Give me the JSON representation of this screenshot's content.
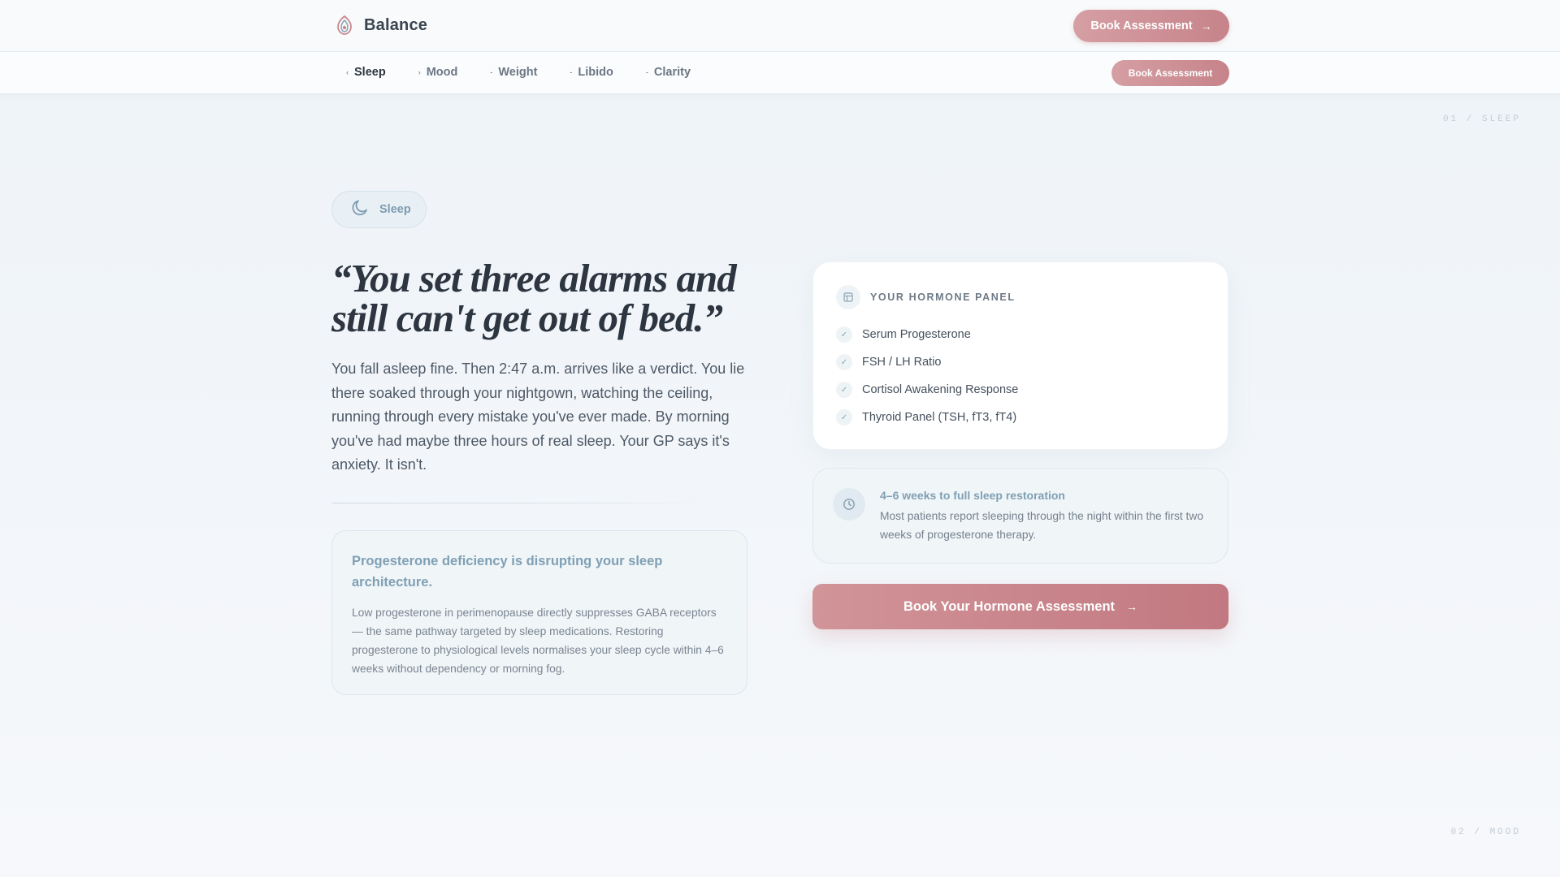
{
  "brand": {
    "name": "Balance"
  },
  "header": {
    "cta_label": "Book Assessment",
    "cta_arrow": "→"
  },
  "subnav": {
    "items": [
      {
        "label": "Sleep",
        "glyph": "‹",
        "active": true
      },
      {
        "label": "Mood",
        "glyph": "›",
        "active": false
      },
      {
        "label": "Weight",
        "glyph": "-",
        "active": false
      },
      {
        "label": "Libido",
        "glyph": "-",
        "active": false
      },
      {
        "label": "Clarity",
        "glyph": "-",
        "active": false
      }
    ],
    "cta_label": "Book Assessment"
  },
  "markers": {
    "current": "01 / SLEEP",
    "next": "02 / MOOD"
  },
  "hero": {
    "chip_label": "Sleep",
    "headline": "“You set three alarms and still can't get out of bed.”",
    "body": "You fall asleep fine. Then 2:47 a.m. arrives like a verdict. You lie there soaked through your nightgown, watching the ceiling, running through every mistake you've ever made. By morning you've had maybe three hours of real sleep. Your GP says it's anxiety. It isn't."
  },
  "insight": {
    "title": "Progesterone deficiency is disrupting your sleep architecture.",
    "body": "Low progesterone in perimenopause directly suppresses GABA receptors — the same pathway targeted by sleep medications. Restoring progesterone to physiological levels normalises your sleep cycle within 4–6 weeks without dependency or morning fog."
  },
  "panel": {
    "title": "YOUR HORMONE PANEL",
    "items": [
      {
        "label": "Serum Progesterone"
      },
      {
        "label": "FSH / LH Ratio"
      },
      {
        "label": "Cortisol Awakening Response"
      },
      {
        "label": "Thyroid Panel (TSH, fT3, fT4)"
      }
    ]
  },
  "timeline": {
    "title": "4–6 weeks to full sleep restoration",
    "body": "Most patients report sleeping through the night within the first two weeks of progesterone therapy."
  },
  "cta": {
    "label": "Book Your Hormone Assessment",
    "arrow": "→"
  },
  "colors": {
    "accent_rose": "#c6838a",
    "accent_blue": "#7fa0b4",
    "text_dark": "#2c3540"
  },
  "icons": {
    "brand": "lotus-logo-icon",
    "chip": "moon-icon",
    "panel": "clipboard-icon",
    "timeline": "clock-icon",
    "check": "check-icon"
  }
}
